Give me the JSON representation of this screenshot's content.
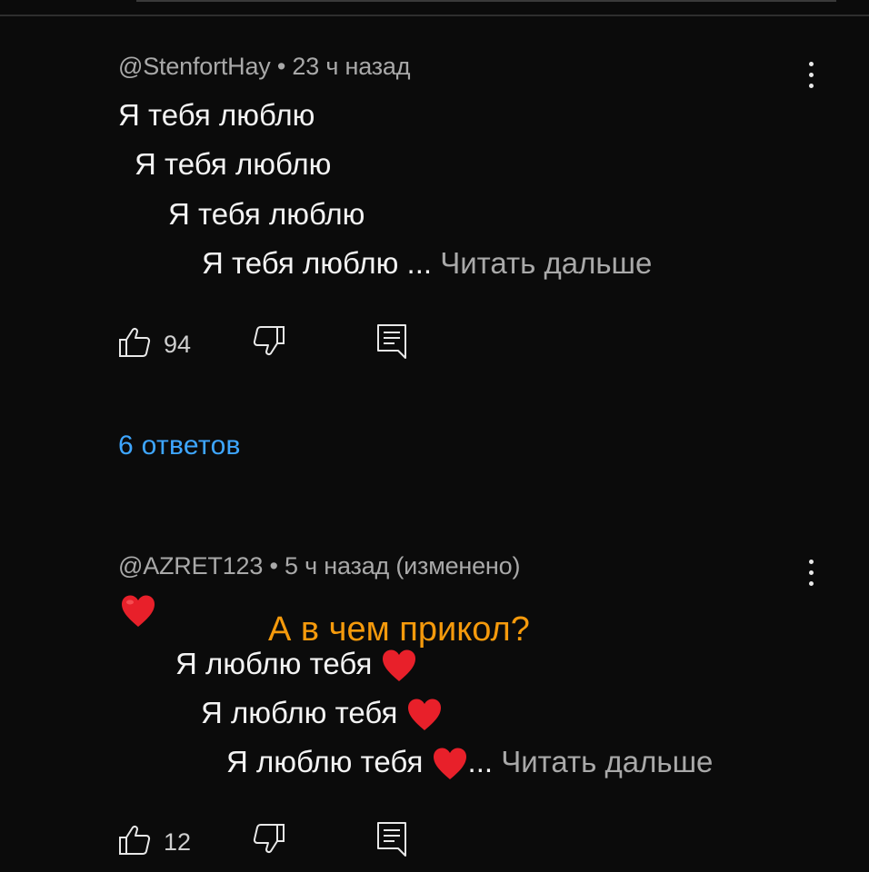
{
  "comments": [
    {
      "meta": "@StenfortHay • 23 ч назад",
      "lines": [
        "Я тебя люблю",
        "Я тебя люблю",
        "Я тебя люблю",
        "Я тебя люблю ..."
      ],
      "read_more": "Читать дальше",
      "likes": "94",
      "replies_label": "6 ответов"
    },
    {
      "meta": "@AZRET123 • 5 ч назад (изменено)",
      "lines": [
        "Я люблю тебя",
        "Я люблю тебя",
        "Я люблю тебя"
      ],
      "ellipsis": "...",
      "read_more": "Читать дальше",
      "likes": "12"
    }
  ],
  "overlay_caption": "А в чем прикол?",
  "icons": {
    "like": "thumb-up-outline",
    "dislike": "thumb-down-outline",
    "reply": "comment-outline",
    "menu": "more-vertical",
    "heart": "red-heart-emoji"
  },
  "colors": {
    "background": "#0b0b0b",
    "link": "#3ea6ff",
    "overlay": "#f59a0c",
    "heart": "#e8202a"
  }
}
